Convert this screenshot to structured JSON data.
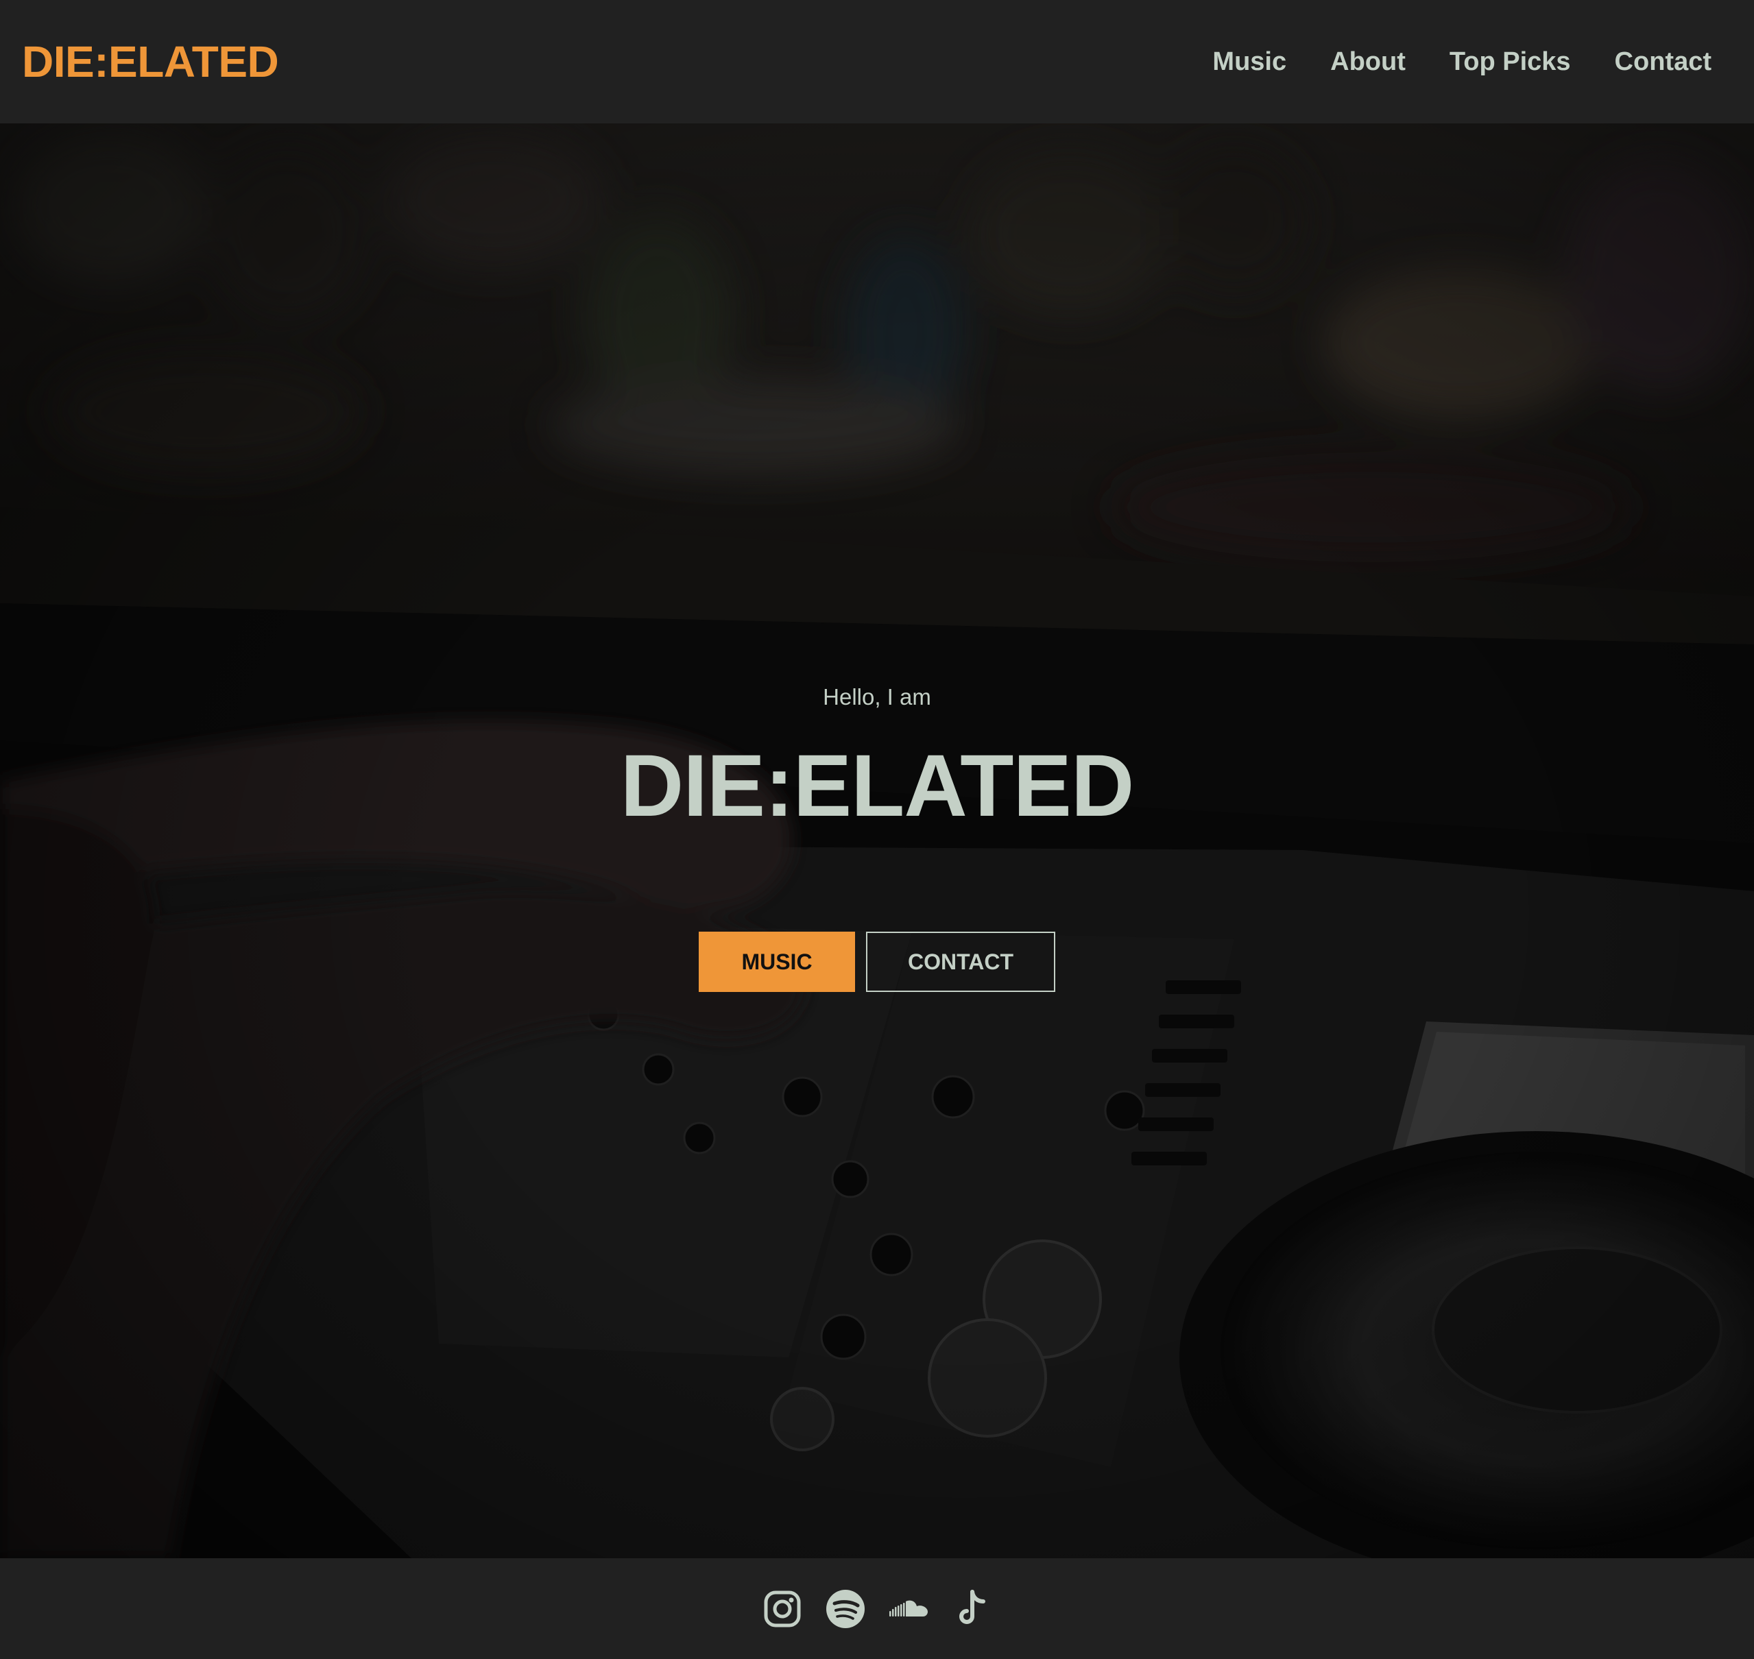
{
  "header": {
    "brand": "DIE:ELATED",
    "nav": [
      {
        "label": "Music"
      },
      {
        "label": "About"
      },
      {
        "label": "Top Picks"
      },
      {
        "label": "Contact"
      }
    ]
  },
  "hero": {
    "greeting": "Hello, I am",
    "title": "DIE:ELATED",
    "background_image": "dj-mixer-crowd-photo",
    "buttons": {
      "primary": "Music",
      "secondary": "Contact"
    }
  },
  "footer": {
    "socials": [
      {
        "icon": "instagram-icon"
      },
      {
        "icon": "spotify-icon"
      },
      {
        "icon": "soundcloud-icon"
      },
      {
        "icon": "tiktok-icon"
      }
    ]
  },
  "colors": {
    "accent": "#ef9638",
    "text": "#c4d0c6",
    "bar_background": "#212121",
    "hero_background": "#0b0b0b"
  }
}
